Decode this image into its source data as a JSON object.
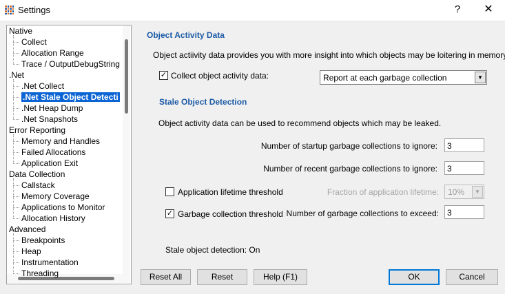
{
  "window": {
    "title": "Settings",
    "help_glyph": "?",
    "close_glyph": "✕"
  },
  "tree": {
    "items": [
      {
        "label": "Native",
        "level": 0
      },
      {
        "label": "Collect",
        "level": 1
      },
      {
        "label": "Allocation Range",
        "level": 1
      },
      {
        "label": "Trace / OutputDebugString",
        "level": 1
      },
      {
        "label": ".Net",
        "level": 0
      },
      {
        "label": ".Net Collect",
        "level": 1
      },
      {
        "label": ".Net Stale Object Detecti",
        "level": 1,
        "selected": true
      },
      {
        "label": ".Net Heap Dump",
        "level": 1
      },
      {
        "label": ".Net Snapshots",
        "level": 1
      },
      {
        "label": "Error Reporting",
        "level": 0
      },
      {
        "label": "Memory and Handles",
        "level": 1
      },
      {
        "label": "Failed Allocations",
        "level": 1
      },
      {
        "label": "Application Exit",
        "level": 1
      },
      {
        "label": "Data Collection",
        "level": 0
      },
      {
        "label": "Callstack",
        "level": 1
      },
      {
        "label": "Memory Coverage",
        "level": 1
      },
      {
        "label": "Applications to Monitor",
        "level": 1
      },
      {
        "label": "Allocation History",
        "level": 1
      },
      {
        "label": "Advanced",
        "level": 0
      },
      {
        "label": "Breakpoints",
        "level": 1
      },
      {
        "label": "Heap",
        "level": 1
      },
      {
        "label": "Instrumentation",
        "level": 1
      },
      {
        "label": "Threading",
        "level": 1
      }
    ]
  },
  "object_activity": {
    "heading": "Object Activity Data",
    "description": "Object actiivity data provides you with more insight into which objects may be loitering in memory.",
    "collect_label": "Collect object activity data:",
    "collect_checked": "✓",
    "mode_value": "Report at each garbage collection",
    "arrow": "▼"
  },
  "stale": {
    "heading": "Stale Object Detection",
    "description": "Object activity data can be used to recommend objects which may be leaked.",
    "startup_label": "Number of startup garbage collections to ignore:",
    "startup_value": "3",
    "recent_label": "Number of recent garbage collections to ignore:",
    "recent_value": "3",
    "lifetime_label": "Application lifetime threshold",
    "lifetime_checked": "",
    "fraction_label": "Fraction of application lifetime:",
    "fraction_value": "10%",
    "gc_label": "Garbage collection threshold",
    "gc_checked": "✓",
    "exceed_label": "Number of garbage collections to exceed:",
    "exceed_value": "3",
    "status": "Stale object detection: On"
  },
  "buttons": {
    "reset_all": "Reset All",
    "reset": "Reset",
    "help": "Help (F1)",
    "ok": "OK",
    "cancel": "Cancel"
  }
}
